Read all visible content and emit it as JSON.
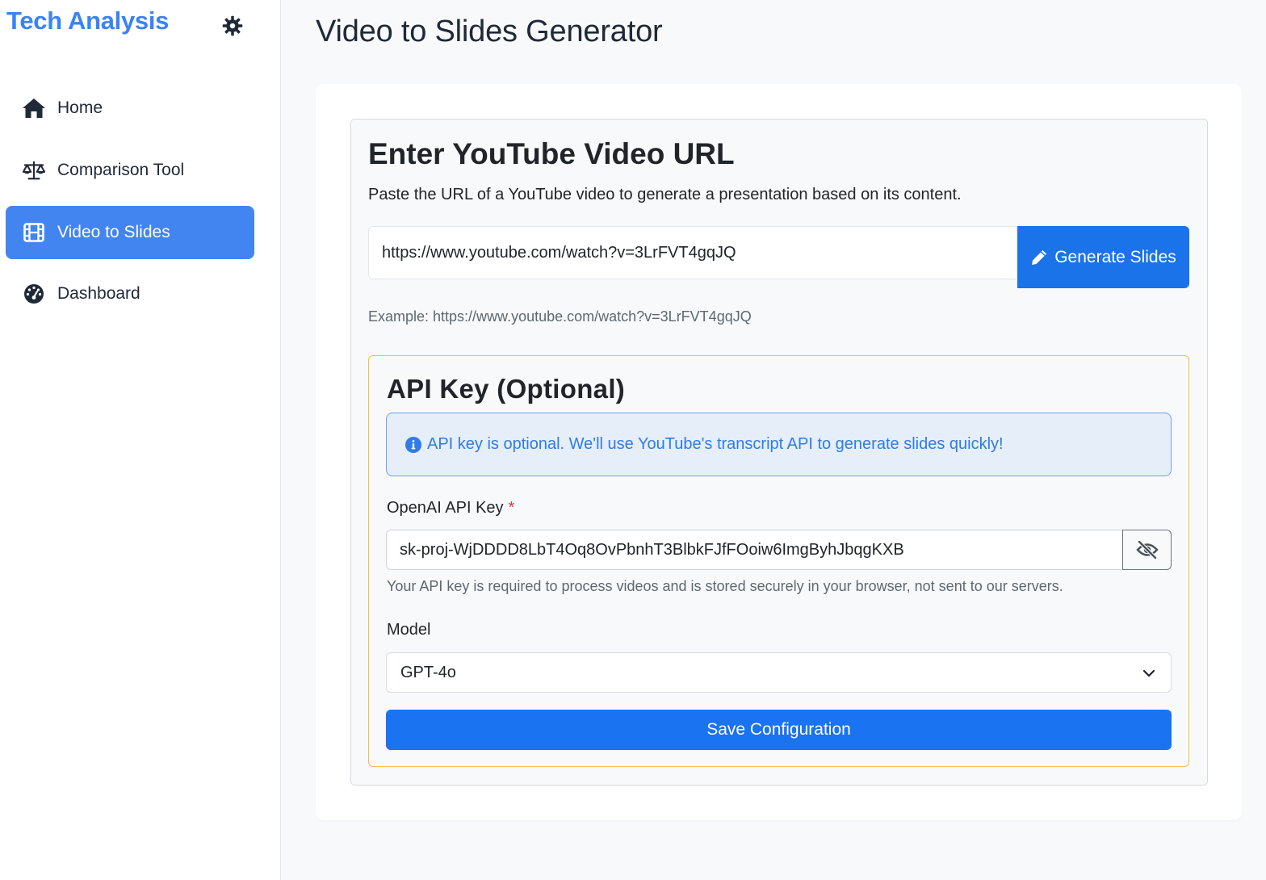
{
  "sidebar": {
    "brand": "Tech Analysis",
    "settings_icon": "gear-icon",
    "items": [
      {
        "label": "Home",
        "icon": "home-icon",
        "active": false
      },
      {
        "label": "Comparison Tool",
        "icon": "scale-icon",
        "active": false
      },
      {
        "label": "Video to Slides",
        "icon": "film-icon",
        "active": true
      },
      {
        "label": "Dashboard",
        "icon": "gauge-icon",
        "active": false
      }
    ]
  },
  "main": {
    "title": "Video to Slides Generator",
    "url_section": {
      "title": "Enter YouTube Video URL",
      "description": "Paste the URL of a YouTube video to generate a presentation based on its content.",
      "url_value": "https://www.youtube.com/watch?v=3LrFVT4gqJQ",
      "generate_label": "Generate Slides",
      "example": "Example: https://www.youtube.com/watch?v=3LrFVT4gqJQ"
    },
    "api_section": {
      "title": "API Key (Optional)",
      "alert": "API key is optional. We'll use YouTube's transcript API to generate slides quickly!",
      "key_label": "OpenAI API Key",
      "required_mark": "*",
      "key_value": "sk-proj-WjDDDD8LbT4Oq8OvPbnhT3BlbkFJfFOoiw6ImgByhJbqgKXB",
      "help": "Your API key is required to process videos and is stored securely in your browser, not sent to our servers.",
      "model_label": "Model",
      "model_value": "GPT-4o",
      "save_label": "Save Configuration"
    }
  },
  "colors": {
    "brand": "#3b82f6",
    "active_nav": "#4285f0",
    "primary_button": "#1a73e8",
    "api_border": "#f0c04a",
    "alert_text": "#2f7be8",
    "required": "#dc3545"
  }
}
